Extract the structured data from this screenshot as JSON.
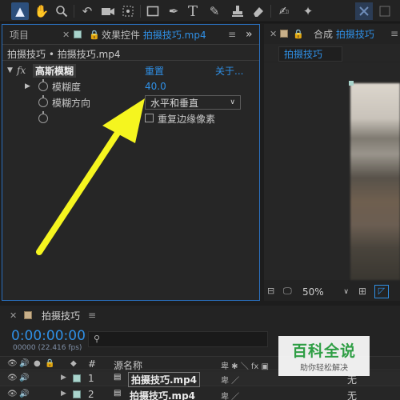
{
  "toolbar": {
    "tools": [
      "selection-tool",
      "hand-tool",
      "zoom-tool",
      "rotation-tool",
      "camera-tool",
      "pan-behind-tool",
      "rectangle-tool",
      "pen-tool",
      "type-tool",
      "brush-tool",
      "clone-stamp-tool",
      "eraser-tool",
      "roto-brush-tool",
      "puppet-pin-tool"
    ],
    "icons": [
      "▲",
      "✋",
      "🔍",
      "↶",
      "■",
      "⊡",
      "□",
      "✒",
      "T",
      "✎",
      "⊥",
      "◆",
      "✍",
      "✦"
    ]
  },
  "effects_panel": {
    "tab_project": "项目",
    "tab_effect_controls_prefix": "效果控件",
    "tab_effect_controls_file": "拍摄技巧.mp4",
    "breadcrumb": "拍摄技巧 • 拍摄技巧.mp4",
    "effect_name": "高斯模糊",
    "reset_label": "重置",
    "about_label": "关于...",
    "blurriness_label": "模糊度",
    "blurriness_value": "40.0",
    "blur_direction_label": "模糊方向",
    "blur_direction_value": "水平和垂直",
    "repeat_edge_label": "重复边缘像素",
    "fx_label": "fx"
  },
  "comp_panel": {
    "tab_prefix": "合成",
    "tab_name": "拍摄技巧",
    "comp_tab": "拍摄技巧",
    "zoom_value": "50%"
  },
  "timeline": {
    "tab_name": "拍摄技巧",
    "timecode": "0:00:00:00",
    "frame_info": "00000 (22.416 fps)",
    "search_placeholder": "",
    "col_number": "#",
    "col_source_name": "源名称",
    "layers": [
      {
        "num": "1",
        "name": "拍摄技巧.mp4",
        "parent": "无"
      },
      {
        "num": "2",
        "name": "拍摄技巧.mp4",
        "parent": "无"
      }
    ]
  },
  "watermark": {
    "title": "百科全说",
    "subtitle": "助你轻松解决"
  },
  "colors": {
    "accent_blue": "#2f8fe5",
    "arrow_yellow": "#f5f51f",
    "watermark_green": "#2e9e44"
  }
}
